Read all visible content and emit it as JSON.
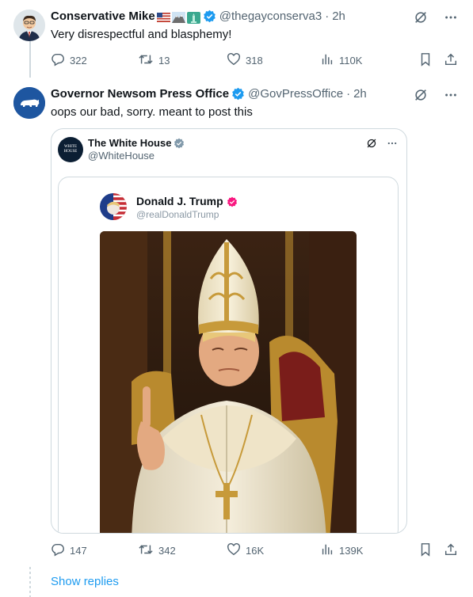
{
  "tweet1": {
    "name": "Conservative Mike",
    "handle": "@thegayconserva3",
    "separator": "·",
    "time": "2h",
    "text": "Very disrespectful and blasphemy!",
    "replies": "322",
    "retweets": "13",
    "likes": "318",
    "views": "110K"
  },
  "tweet2": {
    "name": "Governor Newsom Press Office",
    "handle": "@GovPressOffice",
    "separator": "·",
    "time": "2h",
    "text": "oops our bad, sorry. meant to post this",
    "replies": "147",
    "retweets": "342",
    "likes": "16K",
    "views": "139K",
    "quote": {
      "name": "The White House",
      "handle": "@WhiteHouse",
      "logo_text_line1": "WHITE",
      "logo_text_line2": "HOUSE",
      "inner": {
        "name": "Donald J. Trump",
        "handle": "@realDonaldTrump"
      }
    }
  },
  "show_replies": "Show replies",
  "colors": {
    "accent": "#1d9bf0",
    "muted": "#536471",
    "border": "#cfd9de",
    "newsom_avatar": "#1e56a0",
    "trump_verified": "#f91880"
  },
  "icons": [
    "grok-icon",
    "more-icon",
    "reply-icon",
    "retweet-icon",
    "like-icon",
    "views-icon",
    "bookmark-icon",
    "share-icon",
    "verified-icon",
    "bear-icon"
  ]
}
